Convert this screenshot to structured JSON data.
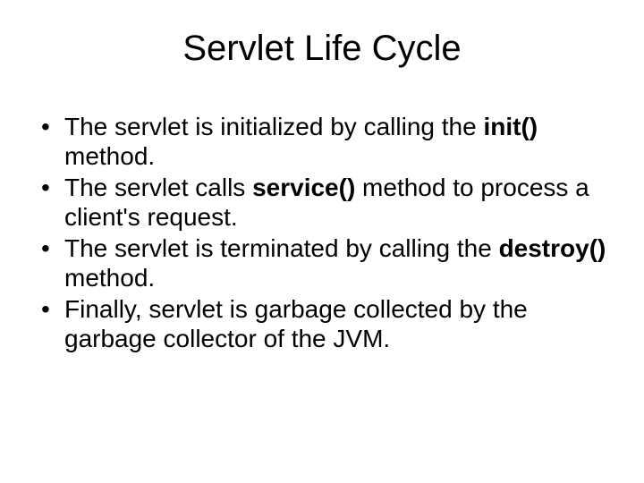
{
  "title": "Servlet Life Cycle",
  "bullets": [
    {
      "pre": "The servlet is initialized by calling the ",
      "strong": "init()",
      "post": " method."
    },
    {
      "pre": "The servlet calls ",
      "strong": "service()",
      "post": " method to process a client's request."
    },
    {
      "pre": "The servlet is terminated by calling the ",
      "strong": "destroy()",
      "post": " method."
    },
    {
      "pre": "Finally, servlet is garbage collected by the garbage collector of the JVM.",
      "strong": "",
      "post": ""
    }
  ]
}
